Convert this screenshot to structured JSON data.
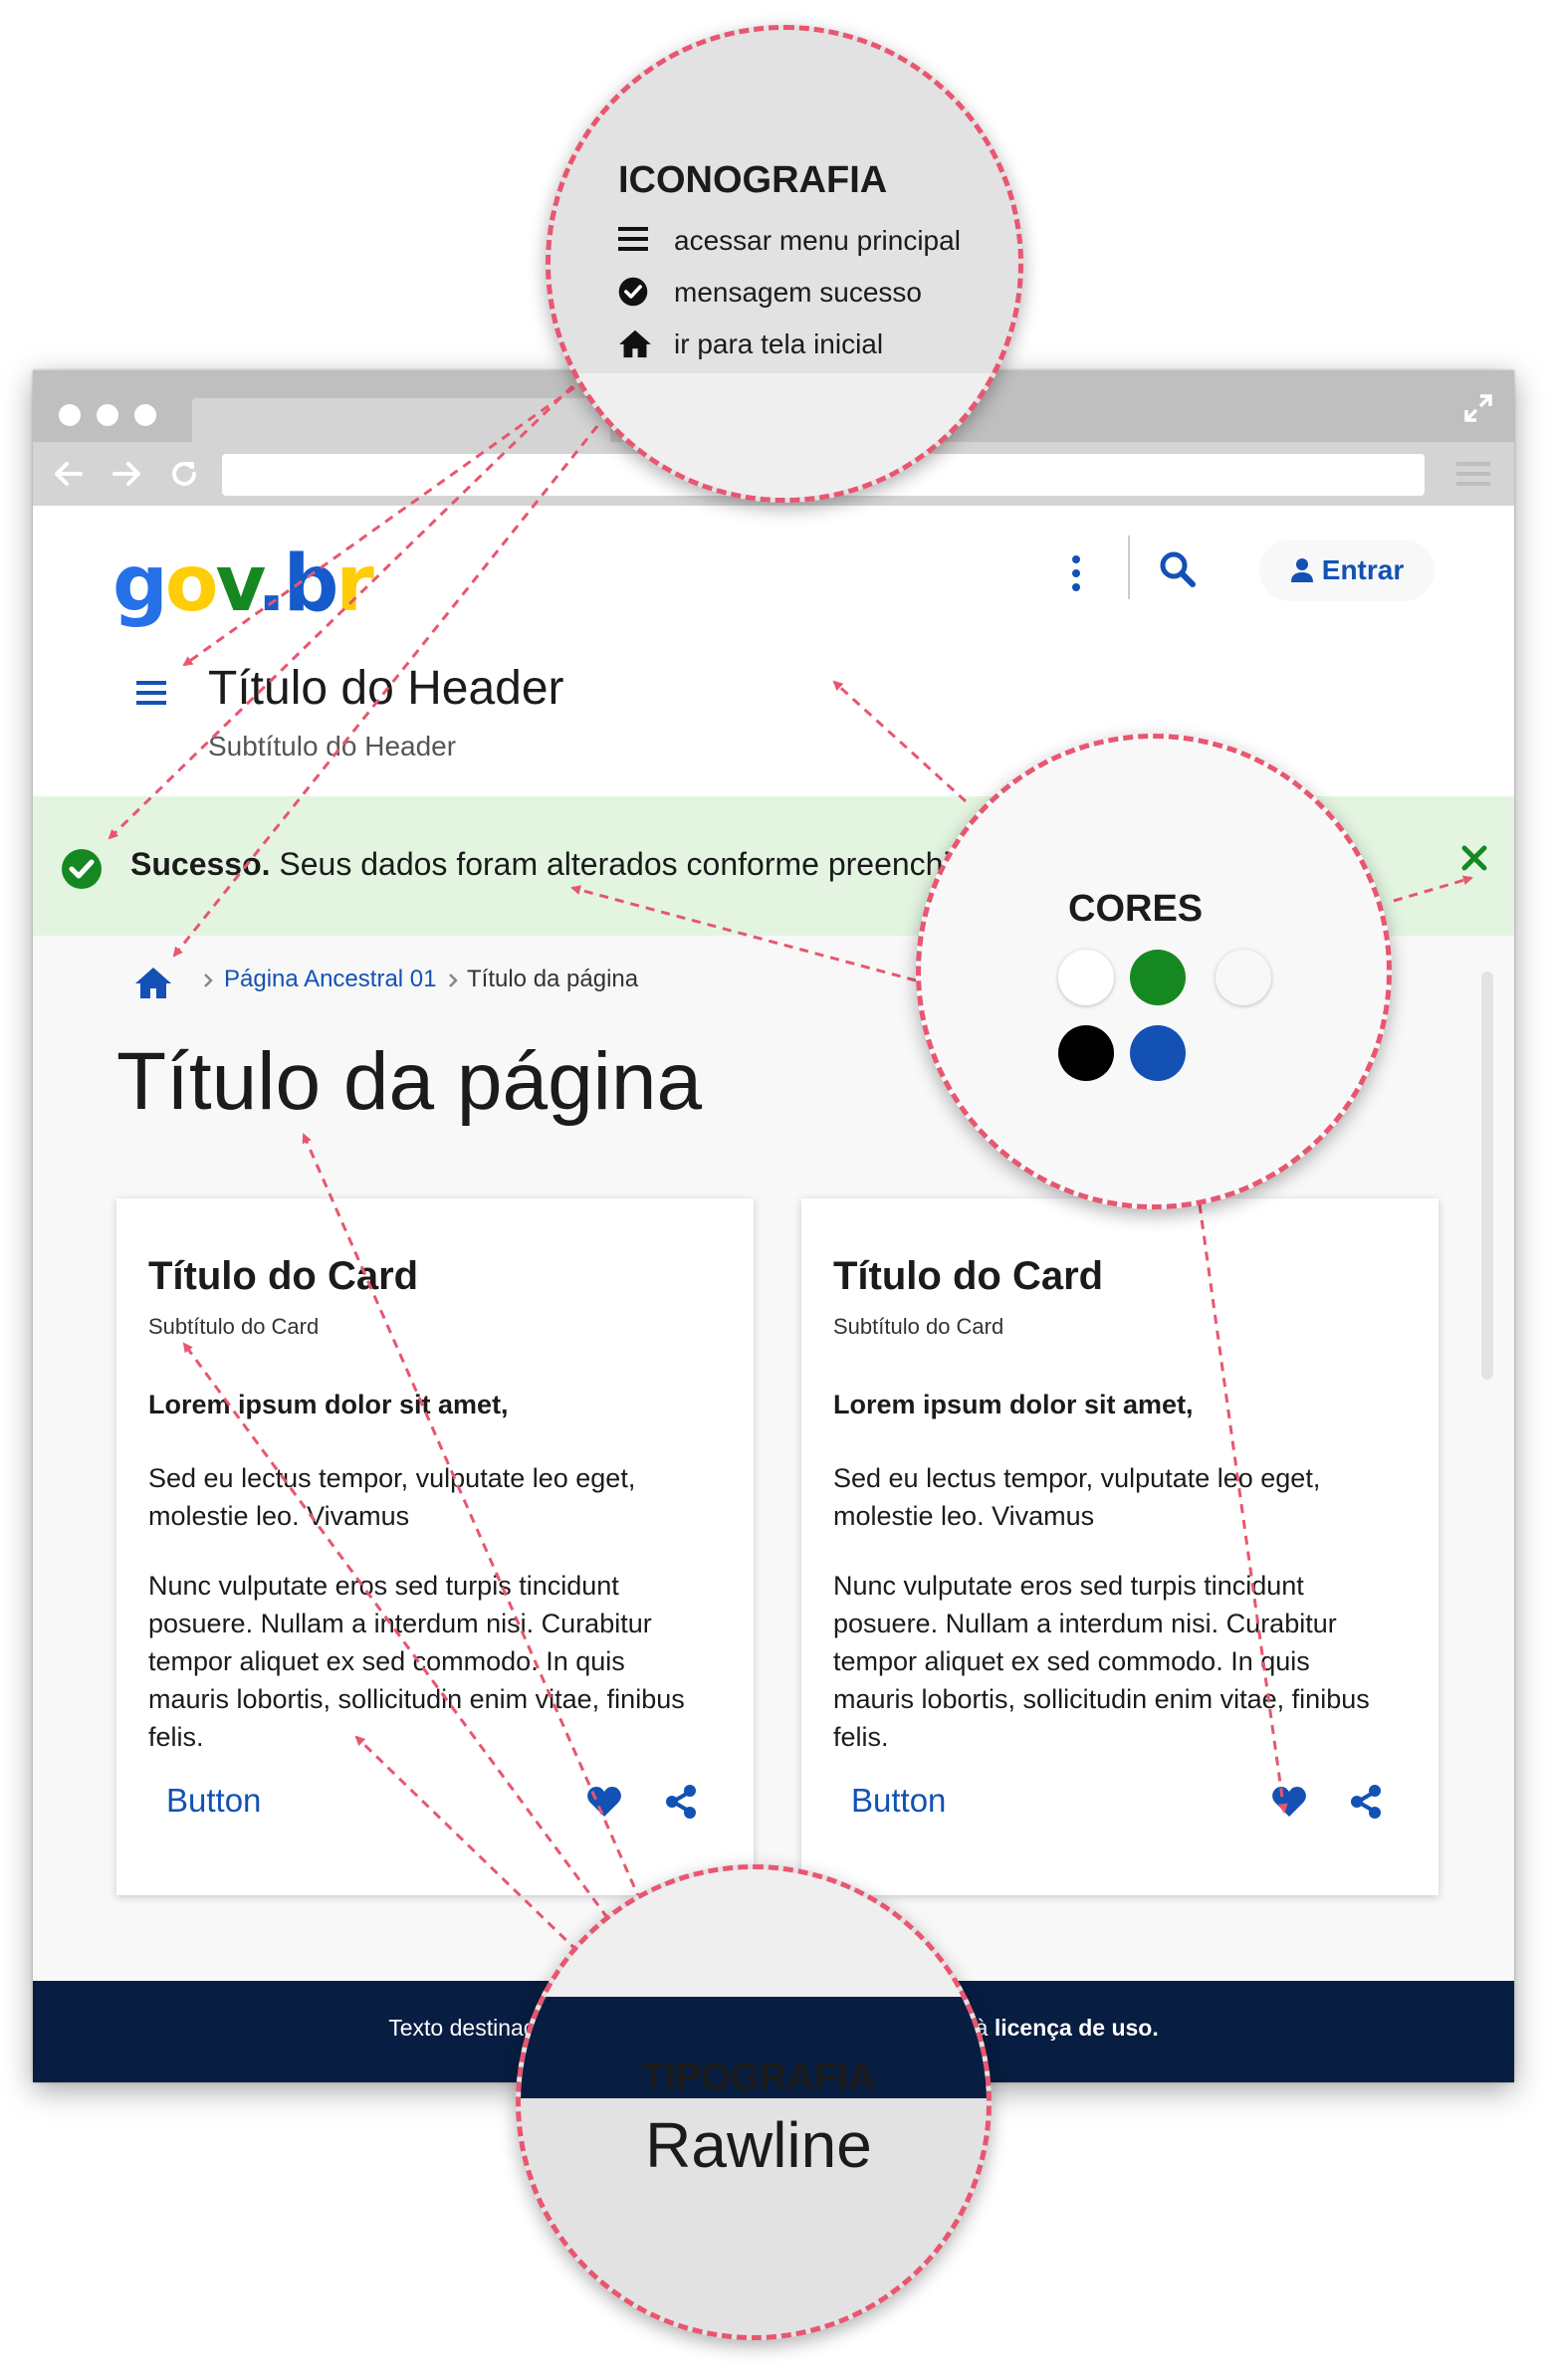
{
  "header": {
    "logo": {
      "g": "g",
      "o": "o",
      "v": "v",
      "dot": ".",
      "b": "b",
      "r": "r"
    },
    "login_label": "Entrar",
    "title": "Título do Header",
    "subtitle": "Subtítulo do Header"
  },
  "alert": {
    "strong": "Sucesso.",
    "message": " Seus dados foram alterados conforme preenchimento."
  },
  "breadcrumb": {
    "items": [
      "Página Ancestral 01",
      "Título da página"
    ]
  },
  "page": {
    "title": "Título da página"
  },
  "cards": [
    {
      "title": "Título do Card",
      "subtitle": "Subtítulo do Card",
      "lead": "Lorem ipsum dolor sit amet,",
      "paragraph1": "Sed eu lectus tempor, vulputate leo eget, molestie leo. Vivamus",
      "paragraph2": "Nunc vulputate eros sed turpis tincidunt posuere. Nullam a interdum nisi. Curabitur tempor aliquet ex sed commodo. In quis mauris lobortis, sollicitudin enim vitae, finibus felis.",
      "button": "Button"
    },
    {
      "title": "Título do Card",
      "subtitle": "Subtítulo do Card",
      "lead": "Lorem ipsum dolor sit amet,",
      "paragraph1": "Sed eu lectus tempor, vulputate leo eget, molestie leo. Vivamus",
      "paragraph2": "Nunc vulputate eros sed turpis tincidunt posuere. Nullam a interdum nisi. Curabitur tempor aliquet ex sed commodo. In quis mauris lobortis, sollicitudin enim vitae, finibus felis.",
      "button": "Button"
    }
  ],
  "footer": {
    "text": "Texto destinado a exibição das informações relacionadas à ",
    "strong": "licença de uso."
  },
  "annotations": {
    "iconografia": {
      "title": "ICONOGRAFIA",
      "items": [
        {
          "icon": "menu-icon",
          "label": "acessar menu principal"
        },
        {
          "icon": "check-circle-icon",
          "label": "mensagem sucesso"
        },
        {
          "icon": "home-icon",
          "label": "ir para tela inicial"
        }
      ]
    },
    "cores": {
      "title": "CORES",
      "swatches": [
        "#ffffff",
        "#168821",
        "#f8f8f8",
        "#000000",
        "#1351b4"
      ]
    },
    "tipografia": {
      "title": "TIPOGRAFIA",
      "font": "Rawline"
    }
  },
  "colors": {
    "primary_blue": "#1351b4",
    "success_green": "#168821",
    "footer_navy": "#071d41",
    "alert_bg": "#e3f5e1",
    "annotation_pink": "#e8566f"
  }
}
